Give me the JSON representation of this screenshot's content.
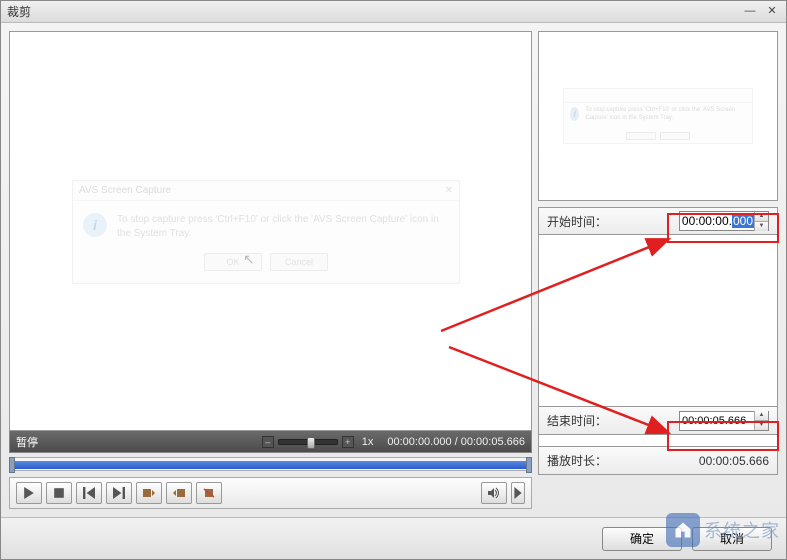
{
  "window": {
    "title": "裁剪"
  },
  "preview_dialog": {
    "title": "AVS Screen Capture",
    "message": "To stop capture press 'Ctrl+F10' or click the 'AVS Screen Capture' icon in the System Tray.",
    "ok": "OK",
    "cancel": "Cancel"
  },
  "status": {
    "pause": "暂停",
    "speed": "1x",
    "time_current": "00:00:00.000",
    "time_sep": " / ",
    "time_total": "00:00:05.666"
  },
  "fields": {
    "start_label": "开始时间：",
    "start_value_prefix": "00:00:00.",
    "start_value_selected": "000",
    "end_label": "结束时间：",
    "end_value": "00:00:05.666",
    "duration_label": "播放时长：",
    "duration_value": "00:00:05.666"
  },
  "buttons": {
    "ok": "确定",
    "cancel": "取消"
  },
  "watermark": "系统之家"
}
